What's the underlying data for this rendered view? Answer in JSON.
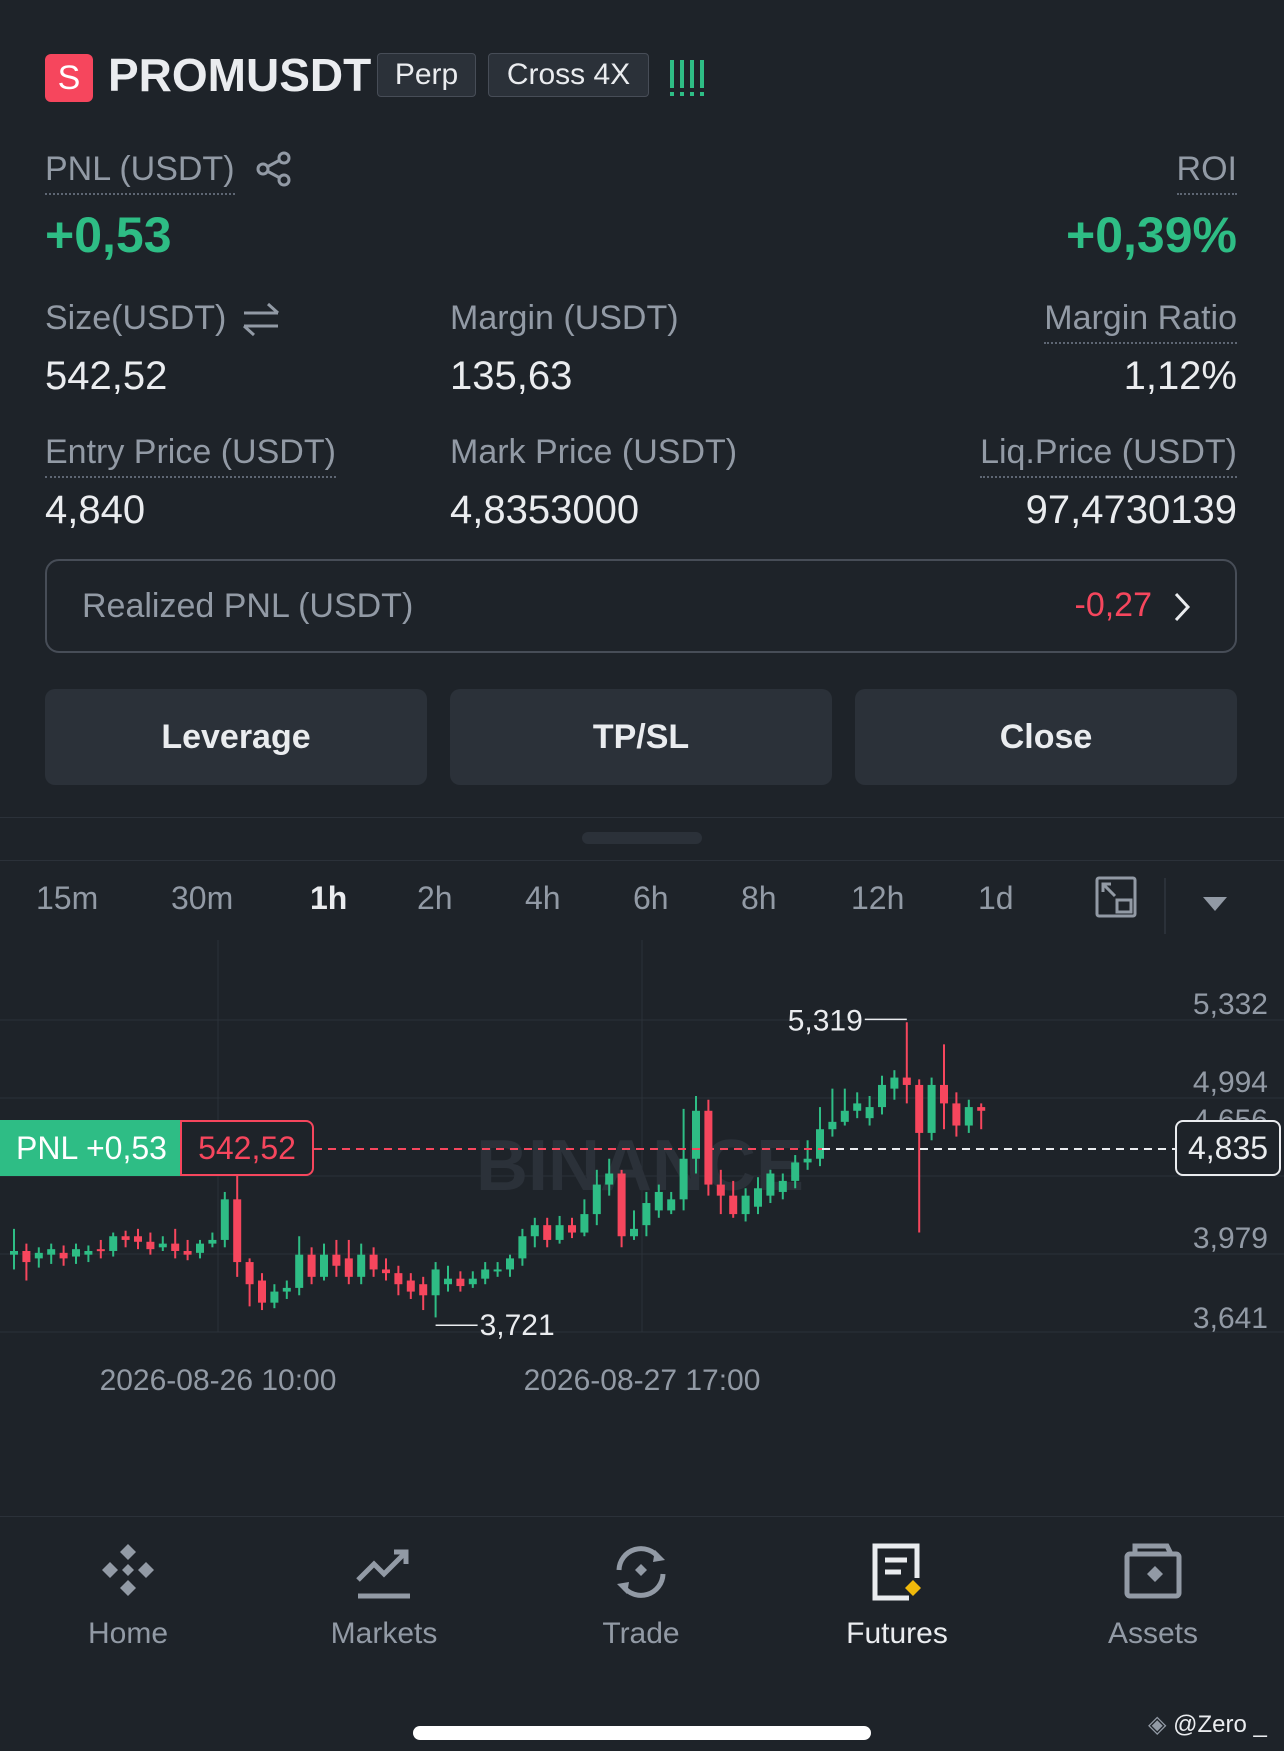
{
  "header": {
    "symbol_badge": "S",
    "symbol": "PROMUSDT",
    "tag_perp": "Perp",
    "tag_cross": "Cross 4X",
    "signal_icon": "signal-bars-icon"
  },
  "position": {
    "pnl_label": "PNL (USDT)",
    "pnl_value": "+0,53",
    "roi_label": "ROI",
    "roi_value": "+0,39%",
    "size_label": "Size(USDT)",
    "size_value": "542,52",
    "margin_label": "Margin (USDT)",
    "margin_value": "135,63",
    "margin_ratio_label": "Margin Ratio",
    "margin_ratio_value": "1,12%",
    "entry_label": "Entry Price (USDT)",
    "entry_value": "4,840",
    "mark_label": "Mark Price (USDT)",
    "mark_value": "4,8353000",
    "liq_label": "Liq.Price (USDT)",
    "liq_value": "97,4730139",
    "realized_label": "Realized PNL (USDT)",
    "realized_value": "-0,27"
  },
  "actions": {
    "leverage": "Leverage",
    "tpsl": "TP/SL",
    "close": "Close"
  },
  "timeframes": [
    "15m",
    "30m",
    "1h",
    "2h",
    "4h",
    "6h",
    "8h",
    "12h",
    "1d"
  ],
  "active_timeframe": "1h",
  "chart": {
    "y_ticks": [
      "5,332",
      "4,994",
      "4,656",
      "4,318",
      "3,979",
      "3,641"
    ],
    "x_ticks": [
      "2026-08-26 10:00",
      "2026-08-27 17:00"
    ],
    "high_label": "5,319",
    "low_label": "3,721",
    "pnl_tag": "PNL +0,53",
    "size_tag": "542,52",
    "current_price": "4,835",
    "watermark": "BINANCE",
    "colors": {
      "up": "#2ebd85",
      "down": "#f6465d",
      "bg": "#1e2329"
    }
  },
  "nav": {
    "home": "Home",
    "markets": "Markets",
    "trade": "Trade",
    "futures": "Futures",
    "assets": "Assets"
  },
  "footer": {
    "credit": "@Zero _"
  }
}
